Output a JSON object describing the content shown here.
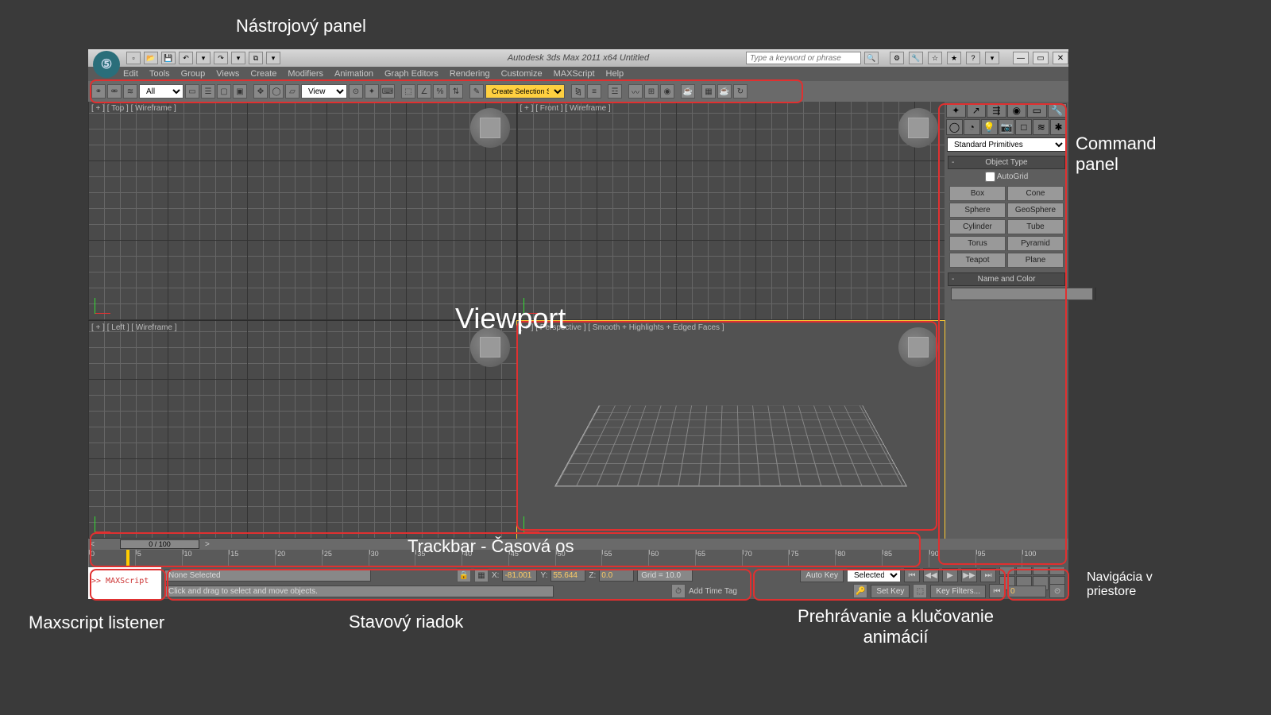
{
  "annotations": {
    "toolbar": "Nástrojový panel",
    "viewport": "Viewport",
    "command": "Command\npanel",
    "trackbar": "Trackbar - Časová os",
    "maxscript": "Maxscript listener",
    "status": "Stavový riadok",
    "playback": "Prehrávanie a klučovanie\nanimácií",
    "nav": "Navigácia v\npriestore"
  },
  "titlebar": {
    "title": "Autodesk 3ds Max 2011 x64    Untitled",
    "search_placeholder": "Type a keyword or phrase"
  },
  "menu": [
    "Edit",
    "Tools",
    "Group",
    "Views",
    "Create",
    "Modifiers",
    "Animation",
    "Graph Editors",
    "Rendering",
    "Customize",
    "MAXScript",
    "Help"
  ],
  "toolbar": {
    "filter": "All",
    "coord": "View",
    "selset": "Create Selection Se"
  },
  "viewports": {
    "tl": "[ + ] [ Top ] [ Wireframe ]",
    "tr": "[ + ] [ Front ] [ Wireframe ]",
    "bl": "[ + ] [ Left ] [ Wireframe ]",
    "br": "[ + ] [ Perspective ] [ Smooth + Highlights + Edged Faces ]"
  },
  "command": {
    "dropdown": "Standard Primitives",
    "object_type": "Object Type",
    "autogrid": "AutoGrid",
    "prims": [
      "Box",
      "Cone",
      "Sphere",
      "GeoSphere",
      "Cylinder",
      "Tube",
      "Torus",
      "Pyramid",
      "Teapot",
      "Plane"
    ],
    "name_color": "Name and Color"
  },
  "timeslider": "0 / 100",
  "ticks": [
    "0",
    "5",
    "10",
    "15",
    "20",
    "25",
    "30",
    "35",
    "40",
    "45",
    "50",
    "55",
    "60",
    "65",
    "70",
    "75",
    "80",
    "85",
    "90",
    "95",
    "100"
  ],
  "status": {
    "maxscript": ">> MAXScript",
    "selection": "None Selected",
    "hint": "Click and drag to select and move objects.",
    "x_label": "X:",
    "x": "-81.001",
    "y_label": "Y:",
    "y": "55.644",
    "z_label": "Z:",
    "z": "0.0",
    "grid": "Grid = 10.0",
    "timetag": "Add Time Tag",
    "autokey": "Auto Key",
    "setkey": "Set Key",
    "selected": "Selected",
    "keyfilters": "Key Filters...",
    "frame": "0"
  }
}
